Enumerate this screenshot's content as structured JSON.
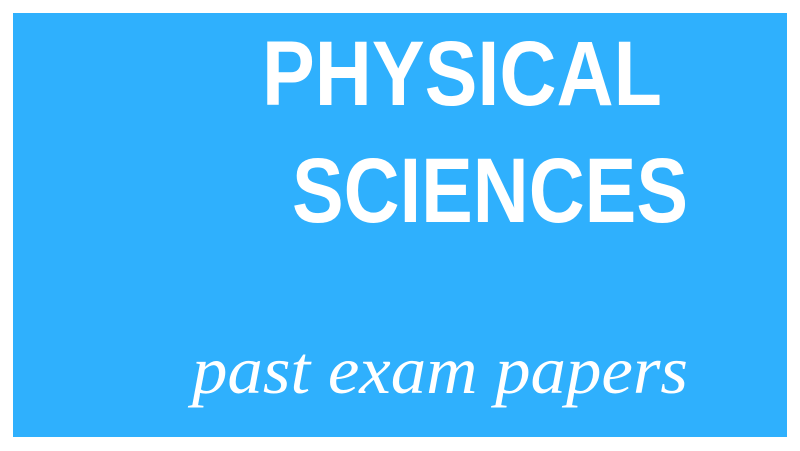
{
  "banner": {
    "title_line1": "PHYSICAL",
    "title_line2": "SCIENCES",
    "subtitle": "past exam papers",
    "background_color": "#2fb0fd",
    "text_color": "#ffffff"
  }
}
